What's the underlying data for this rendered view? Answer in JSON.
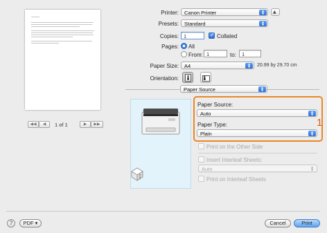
{
  "preview": {
    "page_counter": "1 of 1",
    "nav_first": "◀◀",
    "nav_prev": "◀",
    "nav_next": "▶",
    "nav_last": "▶▶"
  },
  "printer": {
    "label": "Printer:",
    "value": "Canon Printer"
  },
  "presets": {
    "label": "Presets:",
    "value": "Standard"
  },
  "copies": {
    "label": "Copies:",
    "value": "1",
    "collated_label": "Collated",
    "collated_checked": true
  },
  "pages": {
    "label": "Pages:",
    "all_label": "All",
    "from_label": "From:",
    "from_value": "1",
    "to_label": "to:",
    "to_value": "1"
  },
  "paper_size": {
    "label": "Paper Size:",
    "value": "A4",
    "dimensions": "20.99 by 29.70 cm"
  },
  "orientation": {
    "label": "Orientation:"
  },
  "section_popup": {
    "value": "Paper Source"
  },
  "paper_source": {
    "label": "Paper Source:",
    "value": "Auto"
  },
  "paper_type": {
    "label": "Paper Type:",
    "value": "Plain"
  },
  "callout": "1",
  "options": {
    "print_other_side": "Print on the Other Side",
    "insert_interleaf": "Insert Interleaf Sheets:",
    "interleaf_value": "Auto",
    "print_on_interleaf": "Print on Interleaf Sheets"
  },
  "footer": {
    "pdf_label": "PDF ▾",
    "help_label": "?",
    "cancel_label": "Cancel",
    "print_label": "Print"
  },
  "colors": {
    "highlight": "#ed8523",
    "accent": "#2f6fd6",
    "callout": "#d9601b"
  }
}
